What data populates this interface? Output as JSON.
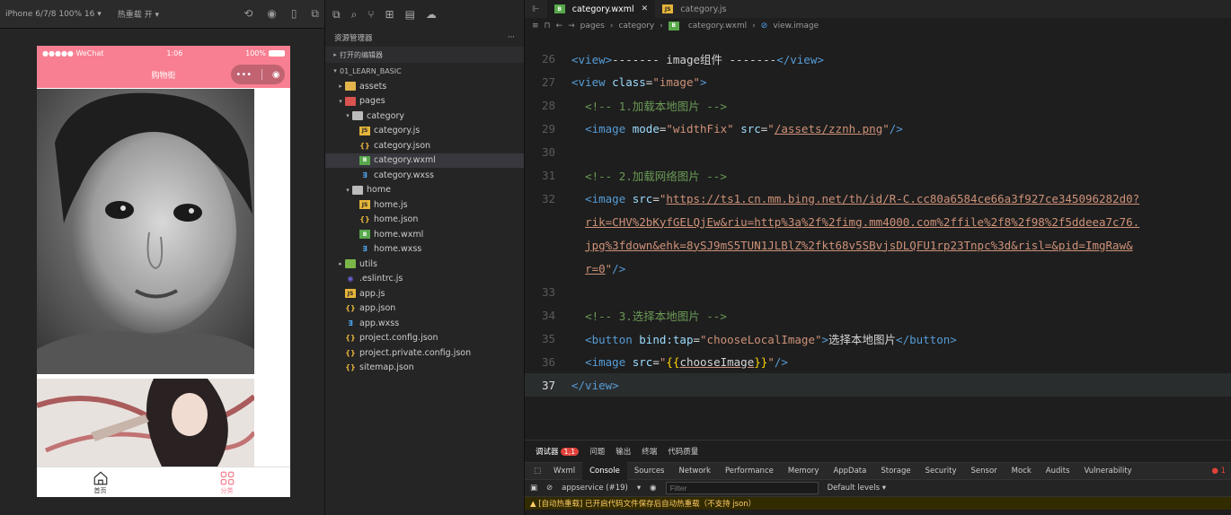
{
  "simulator": {
    "device": "iPhone 6/7/8 100% 16 ▾",
    "hot_reload": "热重载 开 ▾",
    "status": {
      "carrier": "●●●●● WeChat",
      "time": "1:06",
      "battery": "100%"
    },
    "nav_title": "购物街",
    "capsule": {
      "more": "•••",
      "close": "◉"
    },
    "tabbar": [
      {
        "label": "首页"
      },
      {
        "label": "分类"
      }
    ]
  },
  "explorer": {
    "title": "资源管理器",
    "more": "···",
    "open_editors": "打开的编辑器",
    "project": "01_LEARN_BASIC",
    "tree": [
      {
        "label": "assets",
        "depth": 1,
        "arrow": "▸",
        "icon": "folder"
      },
      {
        "label": "pages",
        "depth": 1,
        "arrow": "▾",
        "icon": "folder-red"
      },
      {
        "label": "category",
        "depth": 2,
        "arrow": "▾",
        "icon": "folder-gray"
      },
      {
        "label": "category.js",
        "depth": 3,
        "icon": "js"
      },
      {
        "label": "category.json",
        "depth": 3,
        "icon": "json"
      },
      {
        "label": "category.wxml",
        "depth": 3,
        "icon": "wxml",
        "selected": true
      },
      {
        "label": "category.wxss",
        "depth": 3,
        "icon": "wxss"
      },
      {
        "label": "home",
        "depth": 2,
        "arrow": "▾",
        "icon": "folder-gray"
      },
      {
        "label": "home.js",
        "depth": 3,
        "icon": "js"
      },
      {
        "label": "home.json",
        "depth": 3,
        "icon": "json"
      },
      {
        "label": "home.wxml",
        "depth": 3,
        "icon": "wxml"
      },
      {
        "label": "home.wxss",
        "depth": 3,
        "icon": "wxss"
      },
      {
        "label": "utils",
        "depth": 1,
        "arrow": "▸",
        "icon": "folder-green"
      },
      {
        "label": ".eslintrc.js",
        "depth": 1,
        "icon": "eslint"
      },
      {
        "label": "app.js",
        "depth": 1,
        "icon": "js"
      },
      {
        "label": "app.json",
        "depth": 1,
        "icon": "json"
      },
      {
        "label": "app.wxss",
        "depth": 1,
        "icon": "wxss"
      },
      {
        "label": "project.config.json",
        "depth": 1,
        "icon": "json"
      },
      {
        "label": "project.private.config.json",
        "depth": 1,
        "icon": "json"
      },
      {
        "label": "sitemap.json",
        "depth": 1,
        "icon": "json"
      }
    ]
  },
  "editor": {
    "tabs": [
      {
        "label": "category.wxml",
        "active": true
      },
      {
        "label": "category.js",
        "active": false
      }
    ],
    "breadcrumb": [
      "pages",
      "category",
      "category.wxml",
      "view.image"
    ],
    "lines": [
      {
        "n": "26",
        "parts": [
          [
            "tag",
            "<view>"
          ],
          [
            "plain",
            "------- image组件 -------"
          ],
          [
            "tag",
            "</view>"
          ]
        ]
      },
      {
        "n": "27",
        "parts": [
          [
            "tag",
            "<view "
          ],
          [
            "attr",
            "class"
          ],
          [
            "punct",
            "="
          ],
          [
            "str",
            "\"image\""
          ],
          [
            "tag",
            ">"
          ]
        ]
      },
      {
        "n": "28",
        "parts": [
          [
            "plain",
            "  "
          ],
          [
            "cmt",
            "<!-- 1.加载本地图片 -->"
          ]
        ]
      },
      {
        "n": "29",
        "parts": [
          [
            "plain",
            "  "
          ],
          [
            "tag",
            "<image "
          ],
          [
            "attr",
            "mode"
          ],
          [
            "punct",
            "="
          ],
          [
            "str",
            "\"widthFix\""
          ],
          [
            "plain",
            " "
          ],
          [
            "attr",
            "src"
          ],
          [
            "punct",
            "="
          ],
          [
            "str",
            "\""
          ],
          [
            "stru",
            "/assets/zznh.png"
          ],
          [
            "str",
            "\""
          ],
          [
            "tag",
            "/>"
          ]
        ]
      },
      {
        "n": "30",
        "parts": []
      },
      {
        "n": "31",
        "parts": [
          [
            "plain",
            "  "
          ],
          [
            "cmt",
            "<!-- 2.加载网络图片 -->"
          ]
        ]
      },
      {
        "n": "32",
        "parts": [
          [
            "plain",
            "  "
          ],
          [
            "tag",
            "<image "
          ],
          [
            "attr",
            "src"
          ],
          [
            "punct",
            "="
          ],
          [
            "str",
            "\""
          ],
          [
            "stru",
            "https://ts1.cn.mm.bing.net/th/id/R-C.cc80a6584ce66a3f927ce345096282d0?"
          ]
        ]
      },
      {
        "n": "",
        "parts": [
          [
            "plain",
            "  "
          ],
          [
            "stru",
            "rik=CHV%2bKyfGELQjEw&riu=http%3a%2f%2fimg.mm4000.com%2ffile%2f8%2f98%2f5ddeea7c76."
          ]
        ]
      },
      {
        "n": "",
        "parts": [
          [
            "plain",
            "  "
          ],
          [
            "stru",
            "jpg%3fdown&ehk=8ySJ9mS5TUN1JLBlZ%2fkt68v5SBvjsDLQFU1rp23Tnpc%3d&risl=&pid=ImgRaw&"
          ]
        ]
      },
      {
        "n": "",
        "parts": [
          [
            "plain",
            "  "
          ],
          [
            "stru",
            "r=0"
          ],
          [
            "str",
            "\""
          ],
          [
            "tag",
            "/>"
          ]
        ]
      },
      {
        "n": "33",
        "parts": []
      },
      {
        "n": "34",
        "parts": [
          [
            "plain",
            "  "
          ],
          [
            "cmt",
            "<!-- 3.选择本地图片 -->"
          ]
        ]
      },
      {
        "n": "35",
        "parts": [
          [
            "plain",
            "  "
          ],
          [
            "tag",
            "<button "
          ],
          [
            "attr",
            "bind:tap"
          ],
          [
            "punct",
            "="
          ],
          [
            "str",
            "\"chooseLocalImage\""
          ],
          [
            "tag",
            ">"
          ],
          [
            "plain",
            "选择本地图片"
          ],
          [
            "tag",
            "</button>"
          ]
        ]
      },
      {
        "n": "36",
        "parts": [
          [
            "plain",
            "  "
          ],
          [
            "tag",
            "<image "
          ],
          [
            "attr",
            "src"
          ],
          [
            "punct",
            "="
          ],
          [
            "str",
            "\""
          ],
          [
            "brace",
            "{{"
          ],
          [
            "plainu",
            "chooseImage"
          ],
          [
            "brace",
            "}}"
          ],
          [
            "str",
            "\""
          ],
          [
            "tag",
            "/>"
          ]
        ]
      },
      {
        "n": "37",
        "parts": [
          [
            "tag",
            "</view>"
          ]
        ],
        "current": true
      }
    ]
  },
  "debug": {
    "tabs": [
      {
        "label": "调试器",
        "active": true,
        "badge": "1,1"
      },
      {
        "label": "问题"
      },
      {
        "label": "输出"
      },
      {
        "label": "终端"
      },
      {
        "label": "代码质量"
      }
    ],
    "devtabs": [
      "Wxml",
      "Console",
      "Sources",
      "Network",
      "Performance",
      "Memory",
      "AppData",
      "Storage",
      "Security",
      "Sensor",
      "Mock",
      "Audits",
      "Vulnerability"
    ],
    "active_devtab": "Console",
    "error_count": "● 1",
    "context": "appservice (#19)",
    "filter_placeholder": "Filter",
    "levels": "Default levels ▾",
    "warning": "▲ [自动热重载] 已开启代码文件保存后自动热重载（不支持 json）"
  }
}
